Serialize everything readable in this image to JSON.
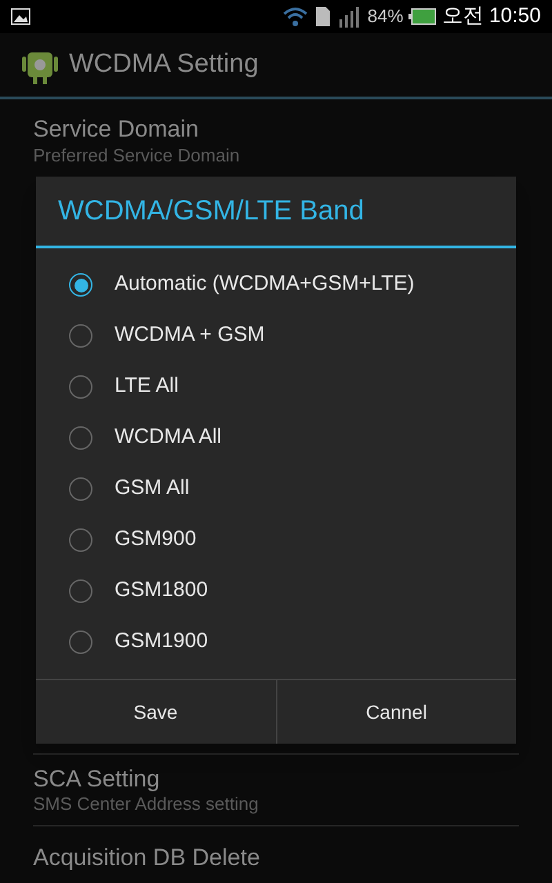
{
  "status_bar": {
    "battery": "84%",
    "time": "오전 10:50"
  },
  "action_bar": {
    "title": "WCDMA Setting"
  },
  "settings": [
    {
      "title": "Service Domain",
      "summary": "Preferred Service Domain"
    },
    {
      "title": "SCA Setting",
      "summary": "SMS Center Address setting"
    },
    {
      "title": "Acquisition DB Delete"
    }
  ],
  "dialog": {
    "title": "WCDMA/GSM/LTE Band",
    "options": [
      {
        "label": "Automatic (WCDMA+GSM+LTE)",
        "selected": true
      },
      {
        "label": "WCDMA + GSM",
        "selected": false
      },
      {
        "label": "LTE All",
        "selected": false
      },
      {
        "label": "WCDMA All",
        "selected": false
      },
      {
        "label": "GSM All",
        "selected": false
      },
      {
        "label": "GSM900",
        "selected": false
      },
      {
        "label": "GSM1800",
        "selected": false
      },
      {
        "label": "GSM1900",
        "selected": false
      }
    ],
    "buttons": [
      "Save",
      "Cannel"
    ]
  }
}
